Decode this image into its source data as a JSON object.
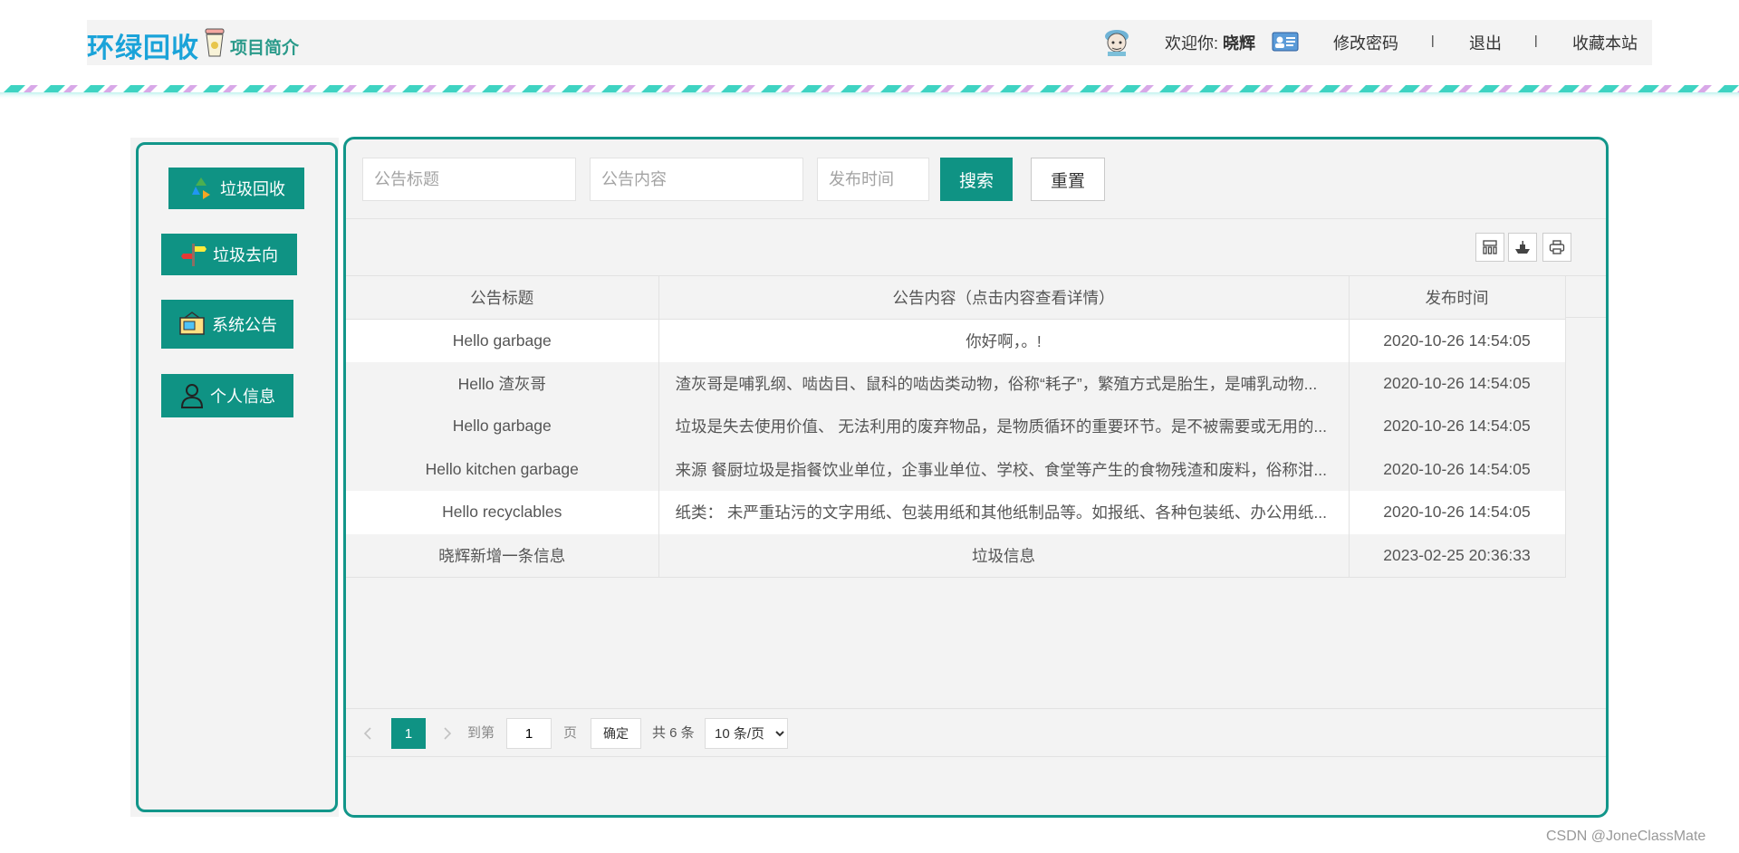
{
  "header": {
    "logo": "环绿回收",
    "project_link": "项目简介",
    "welcome_prefix": "欢迎你:",
    "username": "晓辉",
    "change_password": "修改密码",
    "separator": "|",
    "logout": "退出",
    "bookmark": "收藏本站"
  },
  "sidebar": {
    "items": [
      {
        "label": "垃圾回收",
        "icon": "recycle-icon"
      },
      {
        "label": "垃圾去向",
        "icon": "signpost-icon"
      },
      {
        "label": "系统公告",
        "icon": "bulletin-icon"
      },
      {
        "label": "个人信息",
        "icon": "person-icon"
      }
    ]
  },
  "search": {
    "title_placeholder": "公告标题",
    "content_placeholder": "公告内容",
    "time_placeholder": "发布时间",
    "search_label": "搜索",
    "reset_label": "重置"
  },
  "toolbar": {
    "icons": [
      "columns-icon",
      "export-icon",
      "print-icon"
    ]
  },
  "table": {
    "headers": [
      "公告标题",
      "公告内容（点击内容查看详情）",
      "发布时间"
    ],
    "rows": [
      {
        "title": "Hello garbage",
        "content": "你好啊，。!",
        "time": "2020-10-26 14:54:05"
      },
      {
        "title": "Hello 渣灰哥",
        "content": "渣灰哥是哺乳纲、啮齿目、鼠科的啮齿类动物，俗称“耗子”，繁殖方式是胎生，是哺乳动物...",
        "time": "2020-10-26 14:54:05"
      },
      {
        "title": "Hello garbage",
        "content": "垃圾是失去使用价值、 无法利用的废弃物品，是物质循环的重要环节。是不被需要或无用的...",
        "time": "2020-10-26 14:54:05"
      },
      {
        "title": "Hello kitchen garbage",
        "content": "来源 餐厨垃圾是指餐饮业单位，企事业单位、学校、食堂等产生的食物残渣和废料，俗称泔...",
        "time": "2020-10-26 14:54:05"
      },
      {
        "title": "Hello recyclables",
        "content": "纸类： 未严重玷污的文字用纸、包装用纸和其他纸制品等。如报纸、各种包装纸、办公用纸...",
        "time": "2020-10-26 14:54:05"
      },
      {
        "title": "晓辉新增一条信息",
        "content": "垃圾信息",
        "time": "2023-02-25 20:36:33"
      }
    ]
  },
  "pagination": {
    "current_page": "1",
    "goto_prefix": "到第",
    "goto_value": "1",
    "goto_suffix": "页",
    "confirm": "确定",
    "total": "共 6 条",
    "page_size": "10 条/页"
  },
  "watermark": "CSDN @JoneClassMate",
  "colors": {
    "accent": "#0f9384",
    "logo": "#1aa3d9",
    "panel_bg": "#f3f3f3"
  }
}
